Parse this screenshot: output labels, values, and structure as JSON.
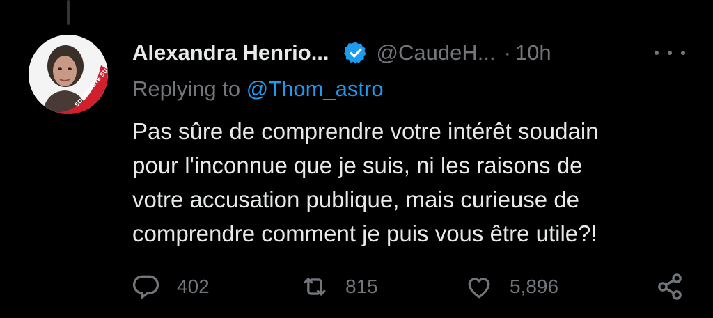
{
  "tweet": {
    "author_name": "Alexandra Henrio...",
    "handle": "@CaudeH...",
    "separator": "·",
    "time": "10h",
    "replying_prefix": "Replying to ",
    "replying_mention": "@Thom_astro",
    "text": "Pas sûre de comprendre votre intérêt soudain\npour l'inconnue que je suis, ni les raisons de\nvotre accusation publique, mais curieuse de\ncomprendre comment je puis vous être utile?!",
    "avatar_badge_text": "SOLIDARITÉ SUSPENDUS"
  },
  "actions": {
    "reply_count": "402",
    "repost_count": "815",
    "like_count": "5,896"
  },
  "icons": {
    "verified": "verified-badge-icon",
    "more": "more-dots-icon",
    "reply": "reply-bubble-icon",
    "repost": "repost-icon",
    "like": "heart-icon",
    "share": "share-icon"
  },
  "colors": {
    "background": "#000000",
    "text_primary": "#e7e9ea",
    "text_secondary": "#71767b",
    "accent_blue": "#1d9bf0",
    "badge_red": "#d0202e"
  }
}
